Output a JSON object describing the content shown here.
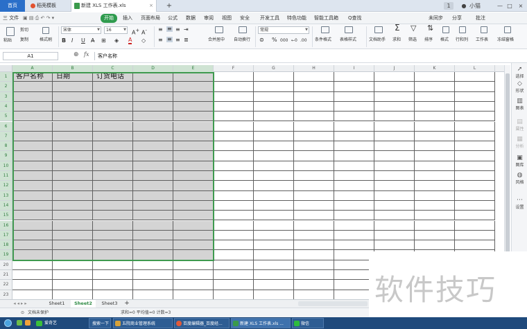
{
  "titlebar": {
    "tabs": [
      {
        "label": "首页"
      },
      {
        "label": "稻壳模板"
      },
      {
        "label": "新建 XLS 工作表.xls"
      }
    ],
    "add_tab": "+",
    "badge": "1",
    "user": "小猫"
  },
  "menubar": {
    "file": "三 文件",
    "items": [
      "开始",
      "插入",
      "页面布局",
      "公式",
      "数据",
      "审阅",
      "视图",
      "安全",
      "开发工具",
      "特色功能",
      "智能工具箱"
    ],
    "search": "Q查找",
    "right": [
      "未同步",
      "分享",
      "批注"
    ]
  },
  "toolbar": {
    "paste": "粘贴",
    "cut": "剪切",
    "copy": "复制",
    "format_painter": "格式刷",
    "font_name": "宋体",
    "font_size": "16",
    "number_format": "常规",
    "merge": "合并居中",
    "wrap": "自动换行",
    "cond_format": "条件格式",
    "table_style": "表格样式",
    "doc_helper": "文档助手",
    "sum": "求和",
    "filter": "筛选",
    "sort": "排序",
    "format": "格式",
    "rowcol": "行和列",
    "worksheet": "工作表",
    "freeze": "冻结窗格",
    "bold": "B",
    "italic": "I",
    "underline": "U",
    "percent": "%",
    "thousands": "000"
  },
  "formula": {
    "cell_ref": "A1",
    "fx": "fx",
    "content": "客户名称"
  },
  "grid": {
    "columns": [
      "A",
      "B",
      "C",
      "D",
      "E",
      "F",
      "G",
      "H",
      "I",
      "J",
      "K",
      "L"
    ],
    "rows": [
      "1",
      "2",
      "3",
      "4",
      "5",
      "6",
      "7",
      "8",
      "9",
      "10",
      "11",
      "12",
      "13",
      "14",
      "15",
      "16",
      "17",
      "18",
      "19",
      "20",
      "21",
      "22",
      "23"
    ],
    "headers": [
      "客户名称",
      "日期",
      "订货电话"
    ]
  },
  "sidepanel": [
    "选择",
    "形状",
    "图表",
    "属性",
    "分析",
    "图库",
    "风格",
    "设置"
  ],
  "sheets": [
    "Sheet1",
    "Sheet2",
    "Sheet3"
  ],
  "add_sheet": "+",
  "status": {
    "protect": "文档未保护",
    "stats": "求和=0  平均值=0  计数=3"
  },
  "taskbar": {
    "items": [
      "爱奇艺",
      "搜索一下",
      "五院商业管理系统",
      "百度编辑器_百度经...",
      "新建 XLS 工作表.xls ...",
      "微信"
    ]
  },
  "watermark": "软件技巧"
}
